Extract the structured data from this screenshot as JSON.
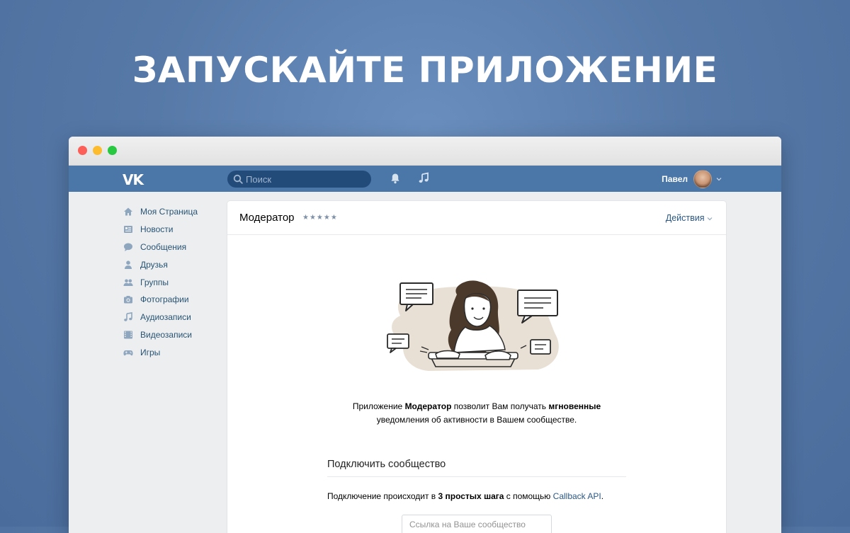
{
  "headline": "ЗАПУСКАЙТЕ ПРИЛОЖЕНИЕ",
  "header": {
    "logo": "VK",
    "search_placeholder": "Поиск",
    "user_name": "Павел"
  },
  "sidebar": {
    "items": [
      {
        "label": "Моя Страница",
        "icon": "home-icon"
      },
      {
        "label": "Новости",
        "icon": "news-icon"
      },
      {
        "label": "Сообщения",
        "icon": "messages-icon"
      },
      {
        "label": "Друзья",
        "icon": "friends-icon"
      },
      {
        "label": "Группы",
        "icon": "groups-icon"
      },
      {
        "label": "Фотографии",
        "icon": "camera-icon"
      },
      {
        "label": "Аудиозаписи",
        "icon": "music-icon"
      },
      {
        "label": "Видеозаписи",
        "icon": "video-icon"
      },
      {
        "label": "Игры",
        "icon": "gamepad-icon"
      }
    ]
  },
  "app": {
    "title": "Модератор",
    "rating": "★★★★★",
    "rating_value": 4.5,
    "actions_label": "Действия",
    "description": {
      "p1": "Приложение ",
      "b1": "Модератор",
      "p2": " позволит Вам получать ",
      "b2": "мгновенные",
      "p3": "уведомления об активности в Вашем сообществе."
    },
    "connect": {
      "title": "Подключить сообщество",
      "text_before": "Подключение происходит в ",
      "text_bold": "3 простых шага",
      "text_middle": " с помощью ",
      "link": "Callback API",
      "text_after": ".",
      "input_placeholder": "Ссылка на Ваше сообщество"
    }
  },
  "colors": {
    "vk_blue": "#4a76a8",
    "link": "#2a5885",
    "sidebar_text": "#285473",
    "illustration_bg": "#e8e0d4"
  }
}
